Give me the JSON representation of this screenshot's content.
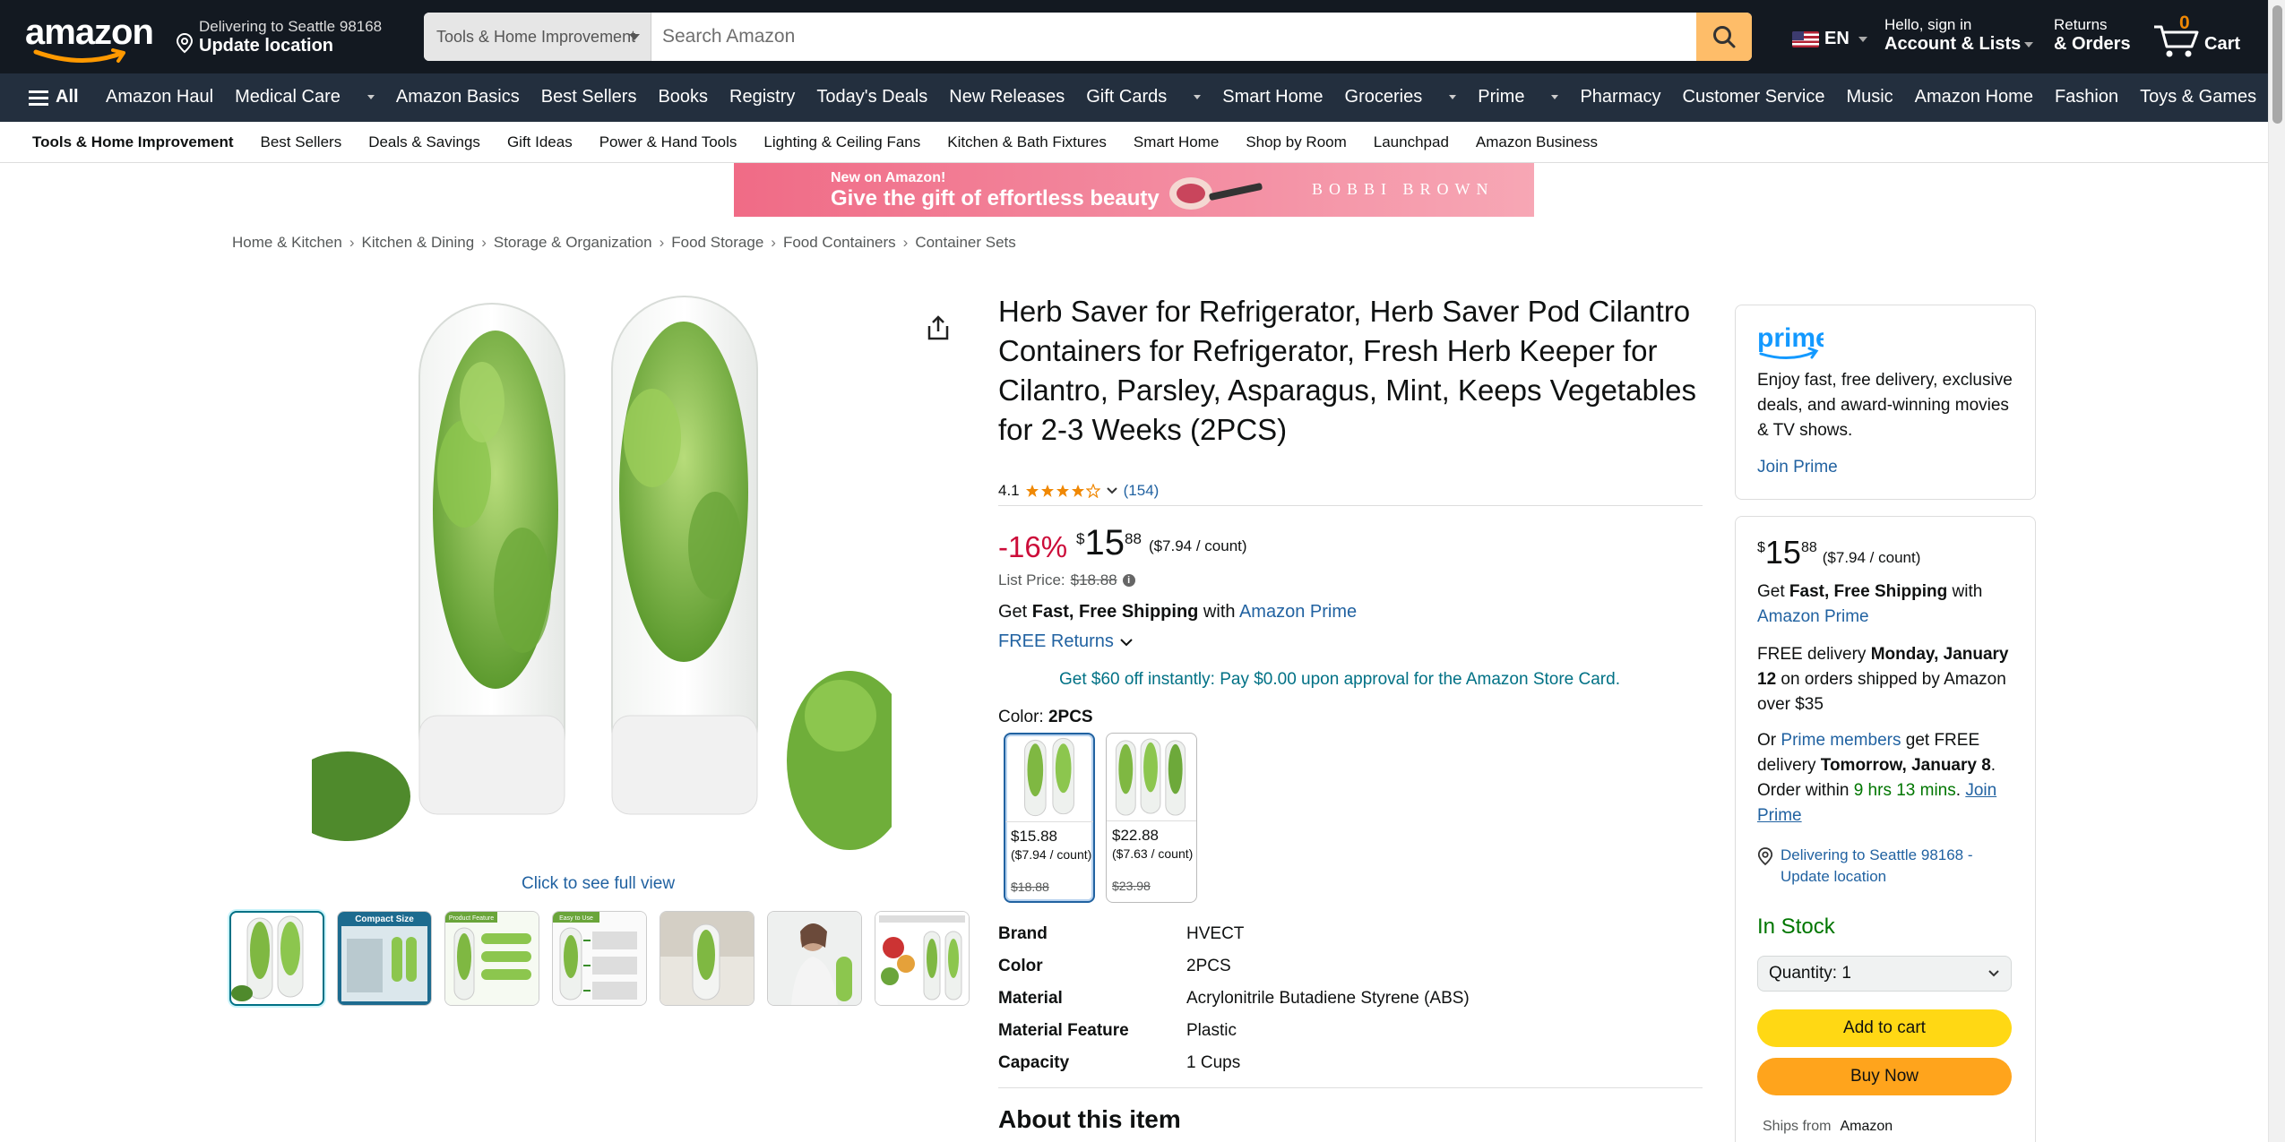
{
  "nav": {
    "logo_text": "amazon",
    "location_line1": "Delivering to Seattle 98168",
    "location_line2": "Update location",
    "search_dept": "Tools & Home Improvement",
    "search_placeholder": "Search Amazon",
    "lang": "EN",
    "account_line1": "Hello, sign in",
    "account_line2": "Account & Lists",
    "orders_line1": "Returns",
    "orders_line2": "& Orders",
    "cart_count": "0",
    "cart_label": "Cart"
  },
  "main_nav": {
    "all_label": "All",
    "items": [
      "Amazon Haul",
      "Medical Care",
      "Amazon Basics",
      "Best Sellers",
      "Books",
      "Registry",
      "Today's Deals",
      "New Releases",
      "Gift Cards",
      "Smart Home",
      "Groceries",
      "Prime",
      "Pharmacy",
      "Customer Service",
      "Music",
      "Amazon Home",
      "Fashion",
      "Toys & Games"
    ]
  },
  "subnav": {
    "items": [
      "Tools & Home Improvement",
      "Best Sellers",
      "Deals & Savings",
      "Gift Ideas",
      "Power & Hand Tools",
      "Lighting & Ceiling Fans",
      "Kitchen & Bath Fixtures",
      "Smart Home",
      "Shop by Room",
      "Launchpad",
      "Amazon Business"
    ]
  },
  "banner": {
    "line1": "New on Amazon!",
    "line2": "Give the gift of effortless beauty",
    "brand": "BOBBI BROWN"
  },
  "breadcrumb": [
    "Home & Kitchen",
    "Kitchen & Dining",
    "Storage & Organization",
    "Food Storage",
    "Food Containers",
    "Container Sets"
  ],
  "product": {
    "title": "Herb Saver for Refrigerator, Herb Saver Pod Cilantro Containers for Refrigerator, Fresh Herb Keeper for Cilantro, Parsley, Asparagus, Mint, Keeps Vegetables for 2-3 Weeks (2PCS)",
    "rating": "4.1",
    "rating_value": 4.1,
    "review_count": "(154)",
    "discount": "-16%",
    "price_symbol": "$",
    "price_whole": "15",
    "price_fraction": "88",
    "unit_price": "($7.94 / count)",
    "list_price_label": "List Price:",
    "list_price": "$18.88",
    "shipping_prefix": "Get ",
    "shipping_bold": "Fast, Free Shipping",
    "shipping_mid": " with ",
    "shipping_link": "Amazon Prime",
    "returns": "FREE Returns",
    "promo": "Get $60 off instantly: Pay $0.00 upon approval for the Amazon Store Card.",
    "color_label": "Color:",
    "color_value": "2PCS",
    "full_view": "Click to see full view",
    "thumb_labels": [
      "Compact Size",
      "Product Feature",
      "Easy to Use"
    ]
  },
  "swatches": [
    {
      "price": "$15.88",
      "unit": "($7.94 / count)",
      "list": "$18.88"
    },
    {
      "price": "$22.88",
      "unit": "($7.63 / count)",
      "list": "$23.98"
    }
  ],
  "specs": [
    {
      "k": "Brand",
      "v": "HVECT"
    },
    {
      "k": "Color",
      "v": "2PCS"
    },
    {
      "k": "Material",
      "v": "Acrylonitrile Butadiene Styrene (ABS)"
    },
    {
      "k": "Material Feature",
      "v": "Plastic"
    },
    {
      "k": "Capacity",
      "v": "1 Cups"
    }
  ],
  "about_heading": "About this item",
  "prime_box": {
    "logo": "prime",
    "text": "Enjoy fast, free delivery, exclusive deals, and award-winning movies & TV shows.",
    "join": "Join Prime"
  },
  "buy_box": {
    "price_symbol": "$",
    "price_whole": "15",
    "price_fraction": "88",
    "unit_price": "($7.94 / count)",
    "ship_prefix": "Get ",
    "ship_bold": "Fast, Free Shipping",
    "ship_mid": " with ",
    "ship_link": "Amazon Prime",
    "delivery_prefix": "FREE delivery ",
    "delivery_date": "Monday, January 12",
    "delivery_suffix": " on orders shipped by Amazon over $35",
    "or_prefix": "Or ",
    "prime_members": "Prime members",
    "or_mid": " get FREE delivery ",
    "fast_date": "Tomorrow, January 8",
    "order_within": ". Order within ",
    "countdown": "9 hrs 13 mins",
    "join_prime": "Join Prime",
    "location": "Delivering to Seattle 98168 - Update location",
    "stock": "In Stock",
    "quantity": "Quantity:  1",
    "add_to_cart": "Add to cart",
    "buy_now": "Buy Now",
    "ships_from_label": "Ships from",
    "ships_from_value": "Amazon"
  },
  "colors": {
    "nav_dark": "#131921",
    "nav_mid": "#232F3E",
    "search_button": "#FEBD69",
    "link": "#2162A1",
    "discount": "#CC0C39",
    "in_stock": "#007600",
    "add_to_cart": "#FFD814",
    "buy_now": "#FFA41C",
    "star": "#F08804"
  }
}
